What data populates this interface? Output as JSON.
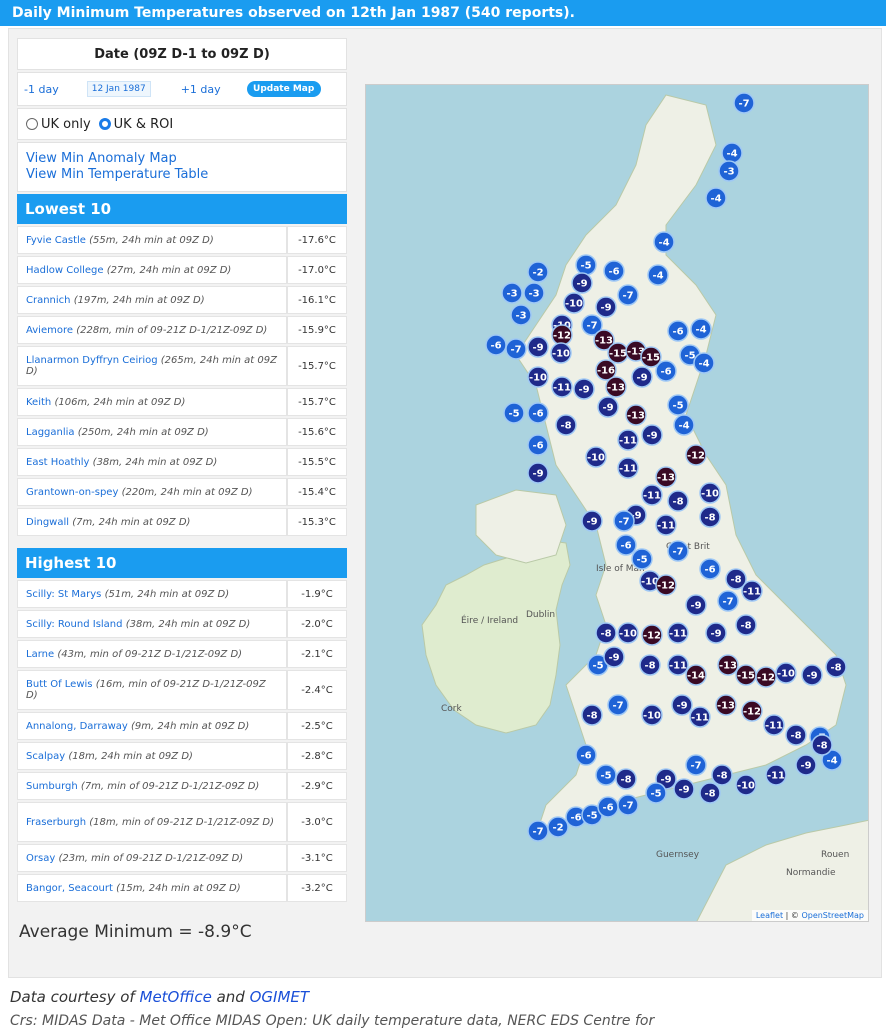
{
  "title": "Daily Minimum Temperatures observed on 12th Jan 1987 (540 reports).",
  "date": {
    "heading": "Date (09Z D-1 to 09Z D)",
    "prev_label": "-1 day",
    "value": "12 Jan 1987",
    "next_label": "+1 day",
    "update_label": "Update Map"
  },
  "region": {
    "options": [
      "UK only",
      "UK & ROI"
    ],
    "selected": "UK & ROI"
  },
  "links": {
    "anomaly": "View Min Anomaly Map",
    "table": "View Min Temperature Table"
  },
  "lowest": {
    "heading": "Lowest 10",
    "rows": [
      {
        "station": "Fyvie Castle",
        "note": "(55m, 24h min at 09Z D)",
        "value": "-17.6°C"
      },
      {
        "station": "Hadlow College",
        "note": "(27m, 24h min at 09Z D)",
        "value": "-17.0°C"
      },
      {
        "station": "Crannich",
        "note": "(197m, 24h min at 09Z D)",
        "value": "-16.1°C"
      },
      {
        "station": "Aviemore",
        "note": "(228m, min of 09-21Z D-1/21Z-09Z D)",
        "value": "-15.9°C"
      },
      {
        "station": "Llanarmon Dyffryn Ceiriog",
        "note": "(265m, 24h min at 09Z D)",
        "value": "-15.7°C"
      },
      {
        "station": "Keith",
        "note": "(106m, 24h min at 09Z D)",
        "value": "-15.7°C"
      },
      {
        "station": "Lagganlia",
        "note": "(250m, 24h min at 09Z D)",
        "value": "-15.6°C"
      },
      {
        "station": "East Hoathly",
        "note": "(38m, 24h min at 09Z D)",
        "value": "-15.5°C"
      },
      {
        "station": "Grantown-on-spey",
        "note": "(220m, 24h min at 09Z D)",
        "value": "-15.4°C"
      },
      {
        "station": "Dingwall",
        "note": "(7m, 24h min at 09Z D)",
        "value": "-15.3°C"
      }
    ]
  },
  "highest": {
    "heading": "Highest 10",
    "rows": [
      {
        "station": "Scilly: St Marys",
        "note": "(51m, 24h min at 09Z D)",
        "value": "-1.9°C"
      },
      {
        "station": "Scilly: Round Island",
        "note": "(38m, 24h min at 09Z D)",
        "value": "-2.0°C"
      },
      {
        "station": "Larne",
        "note": "(43m, min of 09-21Z D-1/21Z-09Z D)",
        "value": "-2.1°C"
      },
      {
        "station": "Butt Of Lewis",
        "note": "(16m, min of 09-21Z D-1/21Z-09Z D)",
        "value": "-2.4°C"
      },
      {
        "station": "Annalong, Darraway",
        "note": "(9m, 24h min at 09Z D)",
        "value": "-2.5°C"
      },
      {
        "station": "Scalpay",
        "note": "(18m, 24h min at 09Z D)",
        "value": "-2.8°C"
      },
      {
        "station": "Sumburgh",
        "note": "(7m, min of 09-21Z D-1/21Z-09Z D)",
        "value": "-2.9°C"
      },
      {
        "station": "Fraserburgh",
        "note": "(18m, min of 09-21Z D-1/21Z-09Z D)",
        "value": "-3.0°C"
      },
      {
        "station": "Orsay",
        "note": "(23m, min of 09-21Z D-1/21Z-09Z D)",
        "value": "-3.1°C"
      },
      {
        "station": "Bangor, Seacourt",
        "note": "(15m, 24h min at 09Z D)",
        "value": "-3.2°C"
      }
    ]
  },
  "average": "Average Minimum = -8.9°C",
  "map": {
    "attribution_leaflet": "Leaflet",
    "attribution_sep": " | © ",
    "attribution_osm": "OpenStreetMap",
    "places": [
      "Isle of Man",
      "Éire / Ireland",
      "Dublin",
      "Cork",
      "Great Brit",
      "Guernsey",
      "Rouen",
      "Normandie"
    ],
    "markers": [
      "-7",
      "-4",
      "-3",
      "-4",
      "-4",
      "-2",
      "-5",
      "-6",
      "-4",
      "-3",
      "-3",
      "-9",
      "-7",
      "-10",
      "-9",
      "-3",
      "-10",
      "-7",
      "-12",
      "-13",
      "-15",
      "-13",
      "-15",
      "-6",
      "-4",
      "-6",
      "-7",
      "-9",
      "-10",
      "-16",
      "-13",
      "-9",
      "-6",
      "-5",
      "-4",
      "-10",
      "-11",
      "-9",
      "-5",
      "-6",
      "-8",
      "-9",
      "-13",
      "-11",
      "-9",
      "-5",
      "-4",
      "-6",
      "-9",
      "-10",
      "-11",
      "-13",
      "-12",
      "-11",
      "-9",
      "-8",
      "-10",
      "-9",
      "-7",
      "-11",
      "-8",
      "-6",
      "-5",
      "-7",
      "-6",
      "-8",
      "-10",
      "-12",
      "-9",
      "-7",
      "-11",
      "-8",
      "-10",
      "-12",
      "-11",
      "-9",
      "-8",
      "-5",
      "-9",
      "-8",
      "-11",
      "-14",
      "-13",
      "-15",
      "-12",
      "-10",
      "-9",
      "-8",
      "-8",
      "-7",
      "-10",
      "-9",
      "-11",
      "-13",
      "-12",
      "-11",
      "-8",
      "-7",
      "-4",
      "-6",
      "-5",
      "-8",
      "-9",
      "-7",
      "-8",
      "-10",
      "-11",
      "-9",
      "-8",
      "-7",
      "-2",
      "-6",
      "-5",
      "-6",
      "-7",
      "-5",
      "-9",
      "-8"
    ]
  },
  "footer": {
    "prefix": "Data courtesy of",
    "link1": "MetOffice",
    "middle": "and",
    "link2": "OGIMET",
    "second_line": "Crs: MIDAS Data - Met Office MIDAS Open: UK daily temperature data, NERC EDS Centre for"
  },
  "colors": {
    "accent": "#1a9cf0",
    "marker_mild": "#1f63d6",
    "marker_cold": "#1f2a8a",
    "marker_coldest": "#3a0a24"
  }
}
